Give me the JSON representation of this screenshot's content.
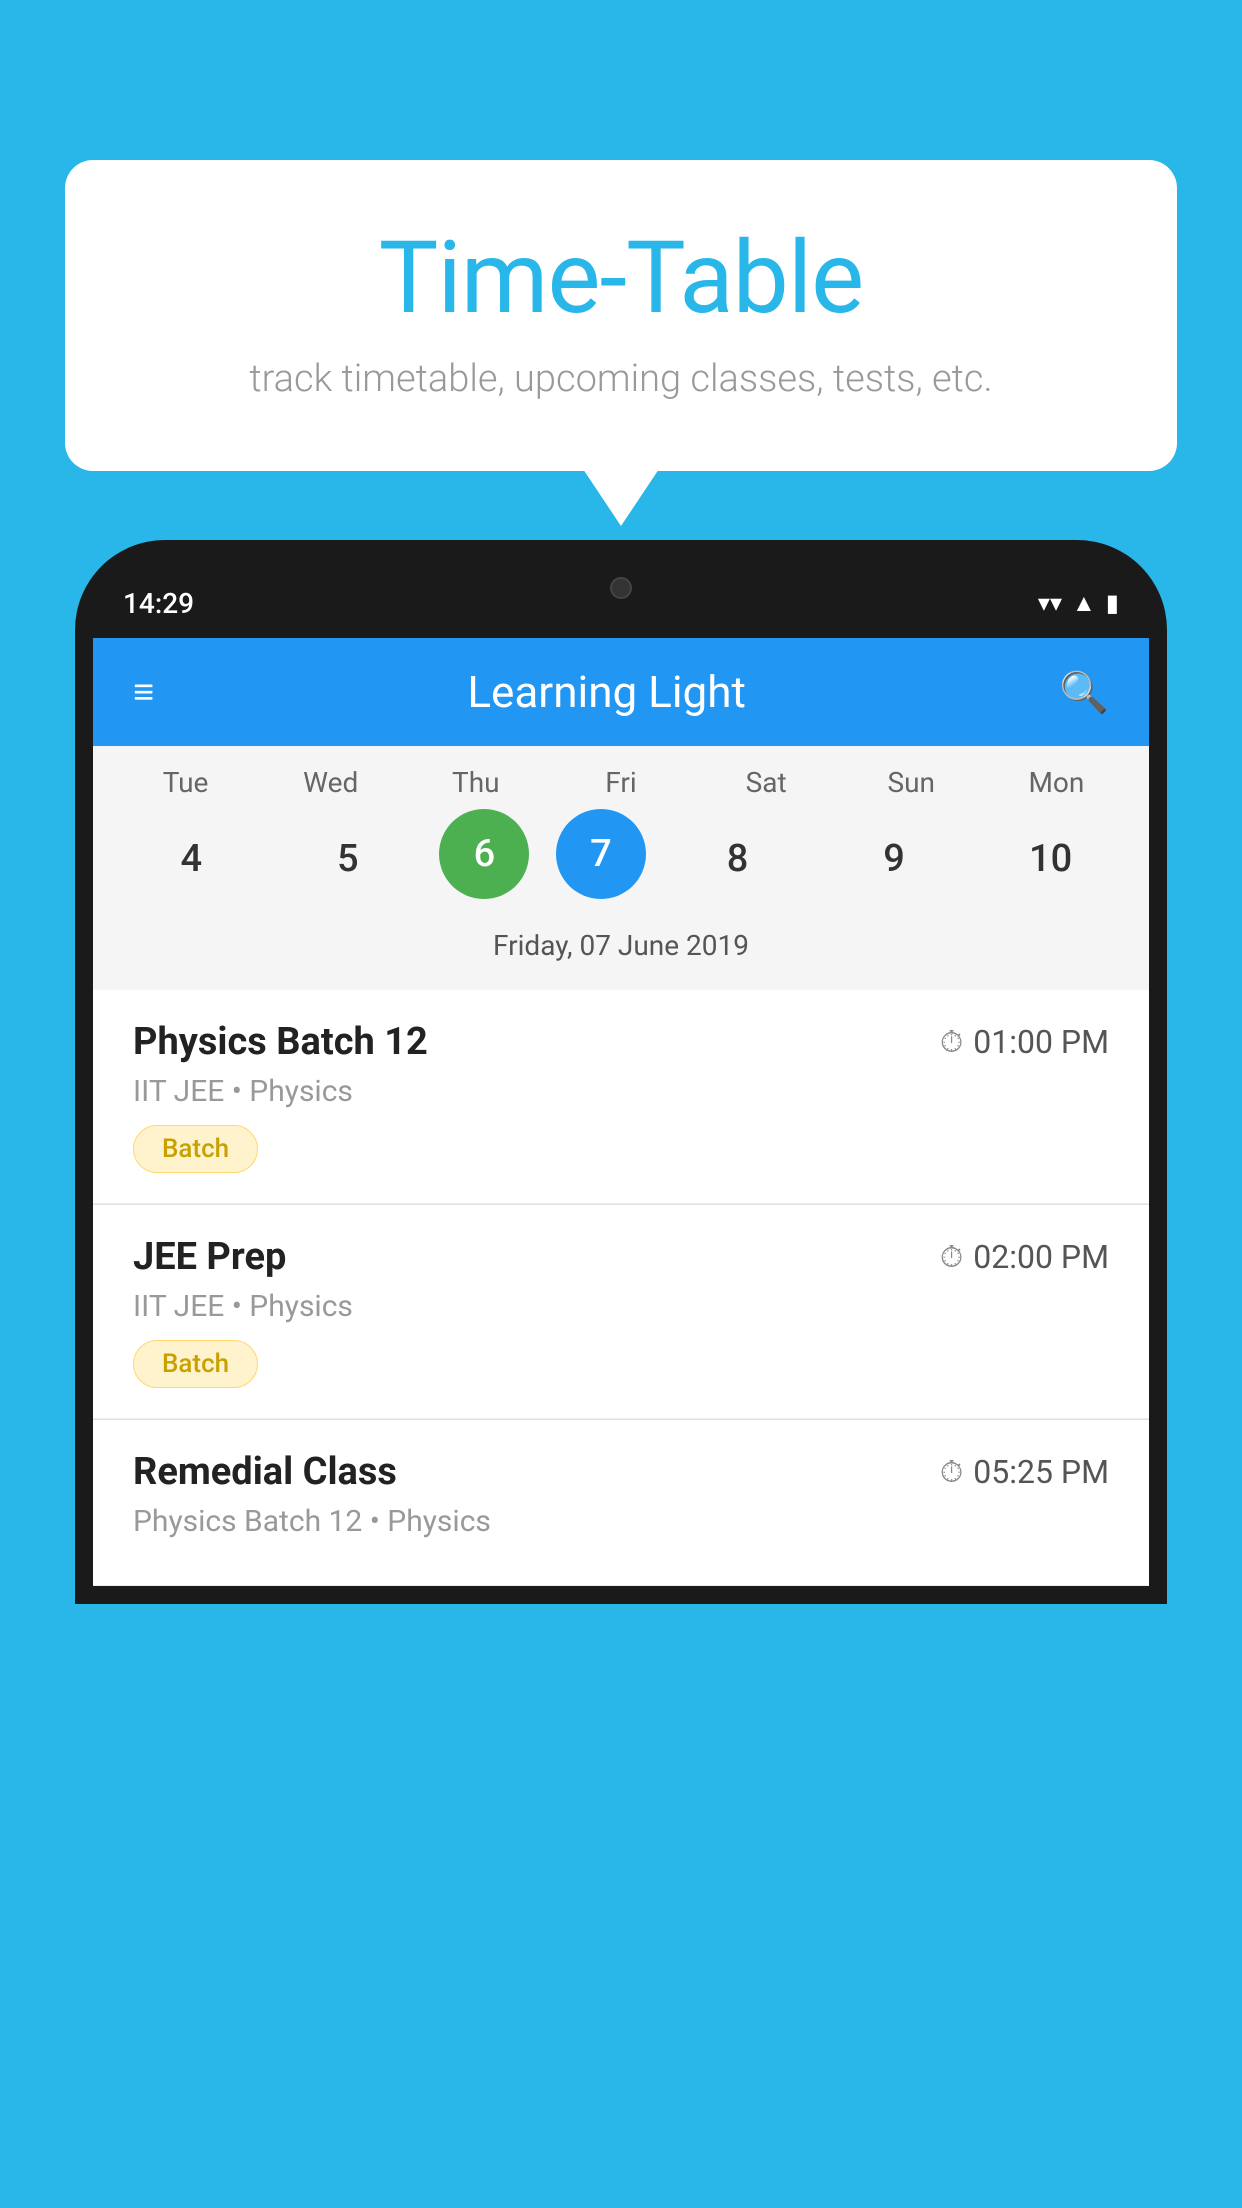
{
  "background_color": "#29B6E8",
  "speech_bubble": {
    "title": "Time-Table",
    "subtitle": "track timetable, upcoming classes, tests, etc."
  },
  "phone": {
    "status_bar": {
      "time": "14:29"
    },
    "app_header": {
      "title": "Learning Light"
    },
    "calendar": {
      "day_names": [
        "Tue",
        "Wed",
        "Thu",
        "Fri",
        "Sat",
        "Sun",
        "Mon"
      ],
      "dates": [
        {
          "num": "4",
          "state": "normal"
        },
        {
          "num": "5",
          "state": "normal"
        },
        {
          "num": "6",
          "state": "today"
        },
        {
          "num": "7",
          "state": "selected"
        },
        {
          "num": "8",
          "state": "normal"
        },
        {
          "num": "9",
          "state": "normal"
        },
        {
          "num": "10",
          "state": "normal"
        }
      ],
      "selected_date_label": "Friday, 07 June 2019"
    },
    "classes": [
      {
        "name": "Physics Batch 12",
        "time": "01:00 PM",
        "subtitle": "IIT JEE • Physics",
        "badge": "Batch"
      },
      {
        "name": "JEE Prep",
        "time": "02:00 PM",
        "subtitle": "IIT JEE • Physics",
        "badge": "Batch"
      },
      {
        "name": "Remedial Class",
        "time": "05:25 PM",
        "subtitle": "Physics Batch 12 • Physics",
        "badge": null
      }
    ]
  },
  "icons": {
    "menu": "≡",
    "search": "🔍",
    "clock": "⏱"
  }
}
